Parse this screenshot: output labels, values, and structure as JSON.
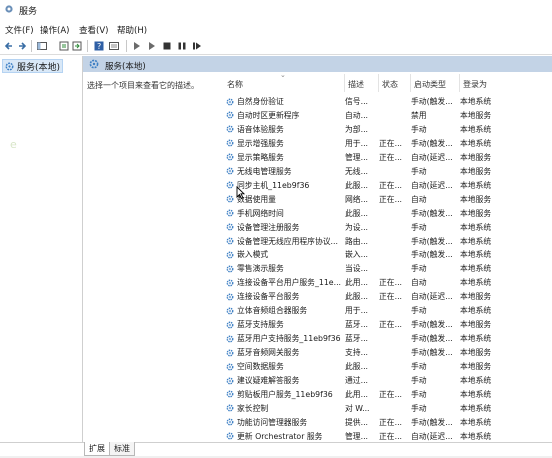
{
  "window": {
    "title": "服务"
  },
  "menu": [
    "文件(F)",
    "操作(A)",
    "查看(V)",
    "帮助(H)"
  ],
  "toolbar": {
    "icons": [
      "back-icon",
      "forward-icon",
      "console-tree-icon",
      "properties-icon",
      "refresh-icon",
      "export-icon",
      "help-icon",
      "view-icon",
      "play-icon",
      "play-alt-icon",
      "stop-icon",
      "pause-icon",
      "restart-icon"
    ]
  },
  "tree": {
    "root_label": "服务(本地)"
  },
  "main": {
    "header_title": "服务(本地)",
    "description_hint": "选择一个项目来查看它的描述。",
    "columns": {
      "name": "名称",
      "desc": "描述",
      "status": "状态",
      "startup": "启动类型",
      "logon": "登录为"
    },
    "rows": [
      {
        "name": "自然身份验证",
        "desc": "信号...",
        "status": "",
        "startup": "手动(触发...",
        "logon": "本地系统"
      },
      {
        "name": "自动时区更新程序",
        "desc": "自动...",
        "status": "",
        "startup": "禁用",
        "logon": "本地服务"
      },
      {
        "name": "语音体验服务",
        "desc": "为部...",
        "status": "",
        "startup": "手动",
        "logon": "本地系统"
      },
      {
        "name": "显示增强服务",
        "desc": "用于...",
        "status": "正在...",
        "startup": "手动(触发...",
        "logon": "本地系统"
      },
      {
        "name": "显示策略服务",
        "desc": "管理...",
        "status": "正在...",
        "startup": "自动(延迟...",
        "logon": "本地服务"
      },
      {
        "name": "无线电管理服务",
        "desc": "无线...",
        "status": "",
        "startup": "手动",
        "logon": "本地服务"
      },
      {
        "name": "同步主机_11eb9f36",
        "desc": "此服...",
        "status": "正在...",
        "startup": "自动(延迟...",
        "logon": "本地系统"
      },
      {
        "name": "数据使用量",
        "desc": "网络...",
        "status": "正在...",
        "startup": "自动",
        "logon": "本地服务"
      },
      {
        "name": "手机网络时间",
        "desc": "此服...",
        "status": "",
        "startup": "手动(触发...",
        "logon": "本地服务"
      },
      {
        "name": "设备管理注册服务",
        "desc": "为设...",
        "status": "",
        "startup": "手动",
        "logon": "本地系统"
      },
      {
        "name": "设备管理无线应用程序协议...",
        "desc": "路由...",
        "status": "",
        "startup": "手动(触发...",
        "logon": "本地系统"
      },
      {
        "name": "嵌入模式",
        "desc": "嵌入...",
        "status": "",
        "startup": "手动(触发...",
        "logon": "本地系统"
      },
      {
        "name": "零售演示服务",
        "desc": "当设...",
        "status": "",
        "startup": "手动",
        "logon": "本地系统"
      },
      {
        "name": "连接设备平台用户服务_11e...",
        "desc": "此用...",
        "status": "正在...",
        "startup": "自动",
        "logon": "本地系统"
      },
      {
        "name": "连接设备平台服务",
        "desc": "此服...",
        "status": "正在...",
        "startup": "自动(延迟...",
        "logon": "本地服务"
      },
      {
        "name": "立体音频组合器服务",
        "desc": "用于...",
        "status": "",
        "startup": "手动",
        "logon": "本地系统"
      },
      {
        "name": "蓝牙支持服务",
        "desc": "蓝牙...",
        "status": "正在...",
        "startup": "手动(触发...",
        "logon": "本地服务"
      },
      {
        "name": "蓝牙用户支持服务_11eb9f36",
        "desc": "蓝牙...",
        "status": "",
        "startup": "手动(触发...",
        "logon": "本地系统"
      },
      {
        "name": "蓝牙音频网关服务",
        "desc": "支持...",
        "status": "",
        "startup": "手动(触发...",
        "logon": "本地服务"
      },
      {
        "name": "空间数据服务",
        "desc": "此服...",
        "status": "",
        "startup": "手动",
        "logon": "本地服务"
      },
      {
        "name": "建议疑难解答服务",
        "desc": "通过...",
        "status": "",
        "startup": "手动",
        "logon": "本地系统"
      },
      {
        "name": "剪贴板用户服务_11eb9f36",
        "desc": "此用...",
        "status": "正在...",
        "startup": "手动",
        "logon": "本地系统"
      },
      {
        "name": "家长控制",
        "desc": "对 W...",
        "status": "",
        "startup": "手动",
        "logon": "本地系统"
      },
      {
        "name": "功能访问管理器服务",
        "desc": "提供...",
        "status": "正在...",
        "startup": "手动(触发...",
        "logon": "本地系统"
      },
      {
        "name": "更新 Orchestrator 服务",
        "desc": "管理...",
        "status": "正在...",
        "startup": "自动(延迟...",
        "logon": "本地系统"
      }
    ]
  },
  "tabs": [
    "扩展",
    "标准"
  ],
  "colors": {
    "header_band": "#c3d3e6",
    "tree_selected": "#d9e8f7",
    "gear": "#3d7fc4"
  }
}
